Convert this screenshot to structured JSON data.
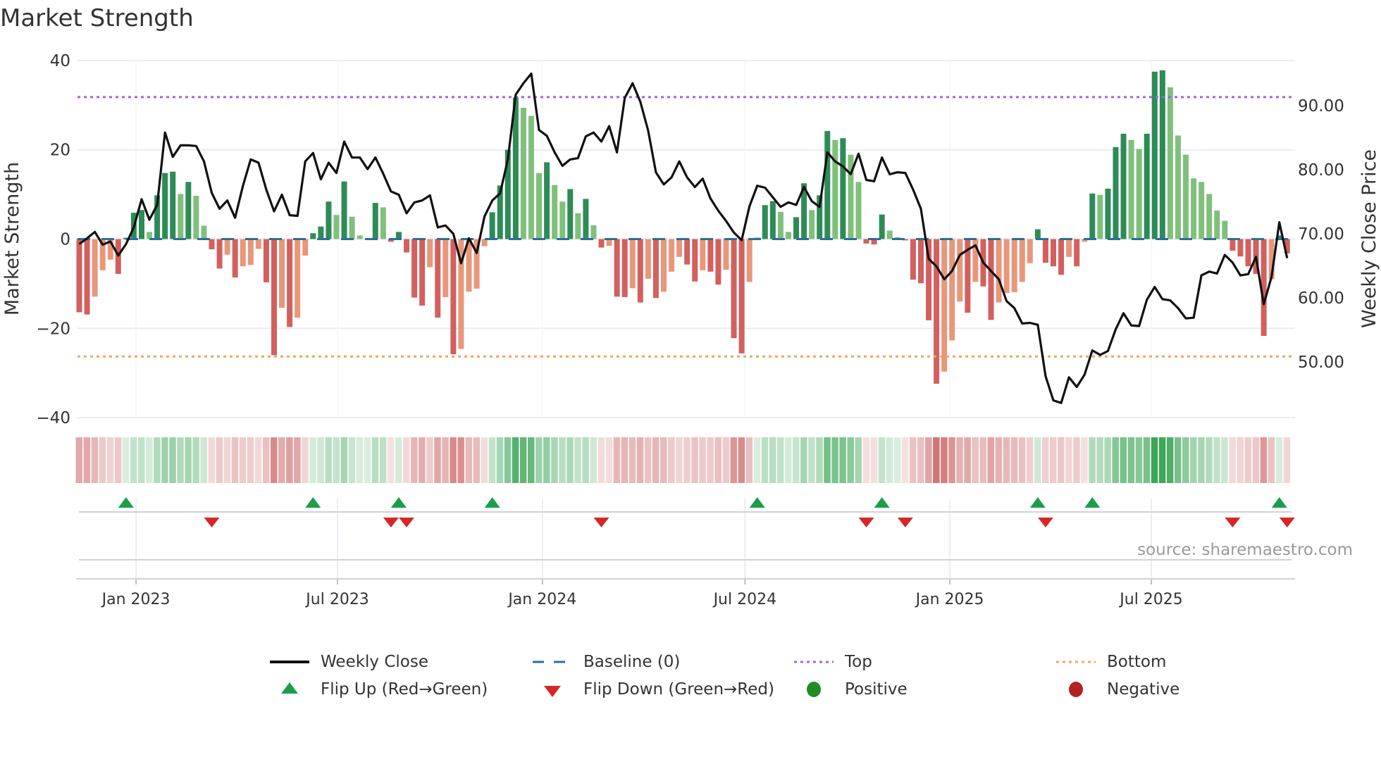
{
  "title": "Market Strength",
  "source": "source: sharemaestro.com",
  "colors": {
    "pos_rising": "#2e8b57",
    "pos_falling": "#80c07c",
    "neg_falling": "#d2605e",
    "neg_rising": "#e8977a",
    "line": "#111111",
    "baseline": "#2a6f9e",
    "top": "#a463e6",
    "bottom": "#f2a55c",
    "flip_up": "#1a9e4a",
    "flip_down": "#d62728",
    "positive": "#228b22",
    "negative": "#b22222",
    "grid": "#e9edf2"
  },
  "chart_data": {
    "type": "bar+line",
    "title": "Market Strength",
    "ylabel": "Market Strength",
    "y2label": "Weekly Close Price",
    "start_date": "2022-11-11",
    "frequency_days": 7,
    "ylim": [
      -40,
      40
    ],
    "yticks": [
      40,
      20,
      0,
      -20,
      -40
    ],
    "yticklabels": [
      "40",
      "20",
      "0",
      "−20",
      "−40"
    ],
    "y2ticks": [
      90,
      80,
      70,
      60,
      50
    ],
    "y2ticklabels": [
      "90.00",
      "80.00",
      "70.00",
      "60.00",
      "50.00"
    ],
    "xticks": [
      {
        "date": "2023-01-01",
        "label": "Jan 2023"
      },
      {
        "date": "2023-07-01",
        "label": "Jul 2023"
      },
      {
        "date": "2024-01-01",
        "label": "Jan 2024"
      },
      {
        "date": "2024-07-01",
        "label": "Jul 2024"
      },
      {
        "date": "2025-01-01",
        "label": "Jan 2025"
      },
      {
        "date": "2025-07-01",
        "label": "Jul 2025"
      }
    ],
    "top_level": 31.8,
    "bottom_level": -26.3,
    "baseline": 0,
    "strength": [
      -16.4,
      -16.9,
      -12.9,
      -7.0,
      -4.6,
      -7.8,
      0.3,
      5.9,
      6.5,
      1.6,
      9.8,
      14.8,
      15.1,
      10.1,
      12.8,
      9.7,
      3.0,
      -2.3,
      -6.6,
      -3.5,
      -8.6,
      -6.1,
      -5.8,
      -2.2,
      -9.7,
      -26.0,
      -15.4,
      -19.7,
      -17.6,
      -3.7,
      1.3,
      2.8,
      8.4,
      5.4,
      12.9,
      5.0,
      0.8,
      0.1,
      8.1,
      7.1,
      -0.6,
      1.6,
      -3.0,
      -13.1,
      -14.9,
      -6.3,
      -17.6,
      -13.0,
      -25.8,
      -24.6,
      -11.8,
      -11.1,
      -1.6,
      6.0,
      12.0,
      20.0,
      31.7,
      29.4,
      27.6,
      14.8,
      17.2,
      12.1,
      8.4,
      11.2,
      5.8,
      9.0,
      3.1,
      -1.9,
      -1.5,
      -12.9,
      -13.0,
      -11.0,
      -14.2,
      -8.9,
      -13.2,
      -11.8,
      -7.3,
      -4.0,
      -5.7,
      -9.5,
      -7.0,
      -7.3,
      -10.2,
      -6.9,
      -22.2,
      -25.6,
      -9.6,
      0.3,
      7.6,
      8.5,
      6.1,
      1.6,
      4.9,
      12.5,
      6.5,
      9.8,
      24.2,
      22.2,
      22.6,
      18.9,
      12.8,
      -1.0,
      -1.2,
      5.5,
      1.9,
      0.4,
      -0.3,
      -9.1,
      -9.9,
      -18.2,
      -32.4,
      -29.7,
      -22.7,
      -14.0,
      -16.5,
      -9.6,
      -10.6,
      -18.1,
      -14.2,
      -12.1,
      -11.9,
      -9.6,
      -5.4,
      2.2,
      -5.3,
      -6.1,
      -8.0,
      -4.0,
      -6.1,
      -0.6,
      10.2,
      9.9,
      11.3,
      20.6,
      23.6,
      22.2,
      20.2,
      23.6,
      37.5,
      37.8,
      34.0,
      23.2,
      18.9,
      13.6,
      12.8,
      10.1,
      6.4,
      4.1,
      -2.6,
      -3.9,
      -6.1,
      -7.8,
      -21.7,
      -9.0,
      0.8,
      -3.2
    ],
    "weekly_close": [
      68.4,
      69.3,
      70.3,
      68.3,
      68.8,
      66.6,
      68.4,
      71.0,
      75.4,
      72.2,
      74.5,
      85.8,
      82.0,
      83.8,
      83.8,
      83.7,
      81.3,
      76.4,
      73.9,
      75.2,
      72.5,
      77.5,
      81.6,
      81.1,
      76.9,
      73.5,
      76.1,
      72.9,
      72.8,
      81.3,
      82.6,
      78.5,
      81.1,
      79.5,
      84.4,
      81.9,
      81.9,
      80.1,
      81.9,
      79.4,
      76.6,
      76.1,
      73.2,
      74.9,
      75.2,
      76.0,
      71.0,
      71.3,
      70.0,
      65.4,
      69.3,
      67.0,
      72.7,
      75.2,
      76.3,
      81.6,
      91.7,
      93.5,
      95.0,
      86.2,
      85.3,
      82.7,
      80.6,
      81.6,
      81.8,
      85.2,
      85.8,
      84.4,
      86.8,
      82.7,
      91.2,
      93.5,
      90.6,
      86.1,
      79.6,
      77.7,
      78.8,
      81.3,
      78.8,
      77.3,
      78.6,
      75.5,
      73.6,
      72.0,
      70.2,
      69.0,
      74.3,
      77.5,
      77.2,
      75.7,
      74.2,
      74.9,
      74.5,
      77.3,
      75.1,
      74.2,
      82.7,
      81.3,
      80.5,
      79.3,
      82.5,
      78.4,
      78.2,
      81.9,
      79.3,
      79.6,
      79.5,
      76.9,
      73.9,
      66.1,
      64.9,
      62.9,
      64.2,
      66.7,
      67.5,
      68.2,
      65.5,
      64.2,
      62.9,
      59.5,
      58.4,
      56.0,
      56.1,
      55.8,
      47.8,
      44.0,
      43.6,
      47.6,
      46.1,
      48.0,
      51.8,
      51.1,
      51.7,
      55.1,
      57.6,
      55.7,
      55.6,
      59.7,
      61.7,
      59.8,
      59.6,
      58.4,
      56.8,
      56.9,
      63.5,
      64.1,
      63.8,
      66.7,
      65.5,
      63.5,
      63.7,
      66.4,
      59.0,
      63.3,
      71.8,
      66.2
    ],
    "flip_up_weeks": [
      6,
      30,
      41,
      53,
      87,
      103,
      123,
      130,
      154
    ],
    "flip_down_weeks": [
      17,
      40,
      42,
      67,
      101,
      106,
      124,
      148,
      155
    ],
    "legend": [
      {
        "key": "weekly_close",
        "label": "Weekly Close",
        "symbol": "solid-line"
      },
      {
        "key": "baseline",
        "label": "Baseline (0)",
        "symbol": "dashed-line"
      },
      {
        "key": "top",
        "label": "Top",
        "symbol": "dotted-line-purple"
      },
      {
        "key": "bottom",
        "label": "Bottom",
        "symbol": "dotted-line-orange"
      },
      {
        "key": "flip_up",
        "label": "Flip Up (Red→Green)",
        "symbol": "triangle-up"
      },
      {
        "key": "flip_down",
        "label": "Flip Down (Green→Red)",
        "symbol": "triangle-down"
      },
      {
        "key": "positive",
        "label": "Positive",
        "symbol": "circle-green"
      },
      {
        "key": "negative",
        "label": "Negative",
        "symbol": "circle-red"
      }
    ],
    "legend_position": "bottom"
  }
}
